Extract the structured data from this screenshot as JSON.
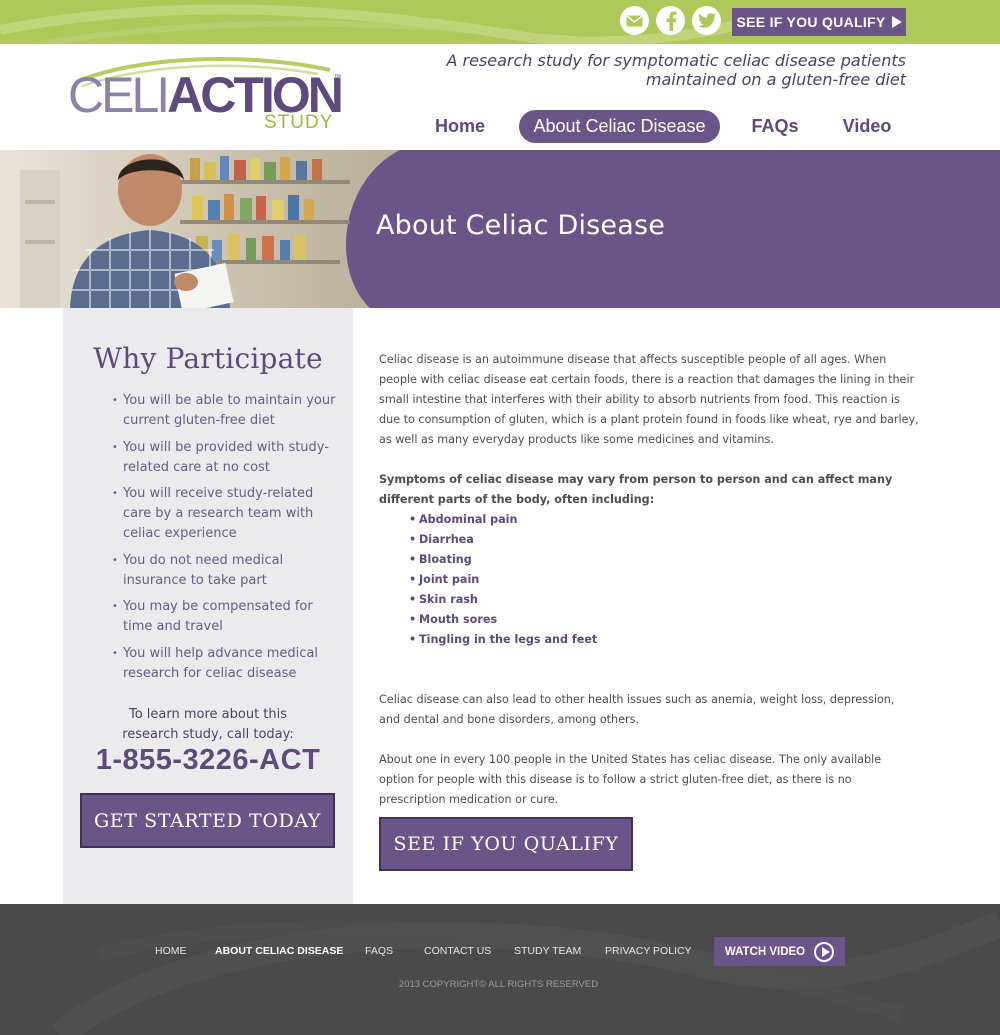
{
  "topbar": {
    "qualify_label": "SEE IF YOU QUALIFY",
    "icons": [
      "mail-icon",
      "facebook-icon",
      "twitter-icon"
    ],
    "colors": {
      "bar": "#afc85a",
      "button": "#6b5588"
    }
  },
  "header": {
    "logo": {
      "celi": "CELI",
      "action": "ACTION",
      "tm": "™",
      "study": "STUDY"
    },
    "tagline_line1": "A research study for symptomatic celiac disease patients",
    "tagline_line2": "maintained on a gluten-free diet",
    "nav": {
      "home": "Home",
      "about": "About Celiac Disease",
      "faqs": "FAQs",
      "video": "Video"
    }
  },
  "hero": {
    "title": "About Celiac Disease",
    "color": "#6b5588"
  },
  "sidebar": {
    "heading": "Why Participate",
    "benefits": [
      "You will be able to maintain your current gluten-free diet",
      "You will be provided with study-related care at no cost",
      "You will receive study-related care by a research team with celiac experience",
      "You do not need medical insurance to take part",
      "You may be compensated for time and travel",
      "You will help advance medical research for celiac disease"
    ],
    "learn_more": "To learn more about this research study, call today:",
    "phone": "1-855-3226-ACT",
    "cta": "GET STARTED TODAY"
  },
  "main": {
    "intro": "Celiac disease is an autoimmune disease that affects susceptible people of all ages. When people with celiac disease eat certain foods, there is a reaction that damages the lining in their small intestine that interferes with their ability to absorb nutrients from food. This reaction is due to consumption of gluten, which is a plant protein found in foods like wheat, rye and barley, as well as many everyday products like some medicines and vitamins.",
    "symptoms_intro": "Symptoms of celiac disease may vary from person to person and can affect many different parts of the body, often including:",
    "symptoms": [
      "Abdominal pain",
      "Diarrhea",
      "Bloating",
      "Joint pain",
      "Skin rash",
      "Mouth sores",
      "Tingling in the legs and feet"
    ],
    "other_issues": "Celiac disease can also lead to other health issues such as anemia, weight loss, depression, and dental and bone disorders, among others.",
    "prevalence": "About one in every 100 people in the United States has celiac disease. The only available option for people with this disease is to follow a strict gluten-free diet, as there is no prescription medication or cure.",
    "cta": "SEE IF YOU QUALIFY"
  },
  "footer": {
    "links": {
      "home": "HOME",
      "about": "ABOUT CELIAC DISEASE",
      "faqs": "FAQS",
      "contact": "CONTACT US",
      "team": "STUDY TEAM",
      "privacy": "PRIVACY POLICY"
    },
    "watch_video": "WATCH VIDEO",
    "copyright": "2013 COPYRIGHT© ALL RIGHTS RESERVED"
  }
}
